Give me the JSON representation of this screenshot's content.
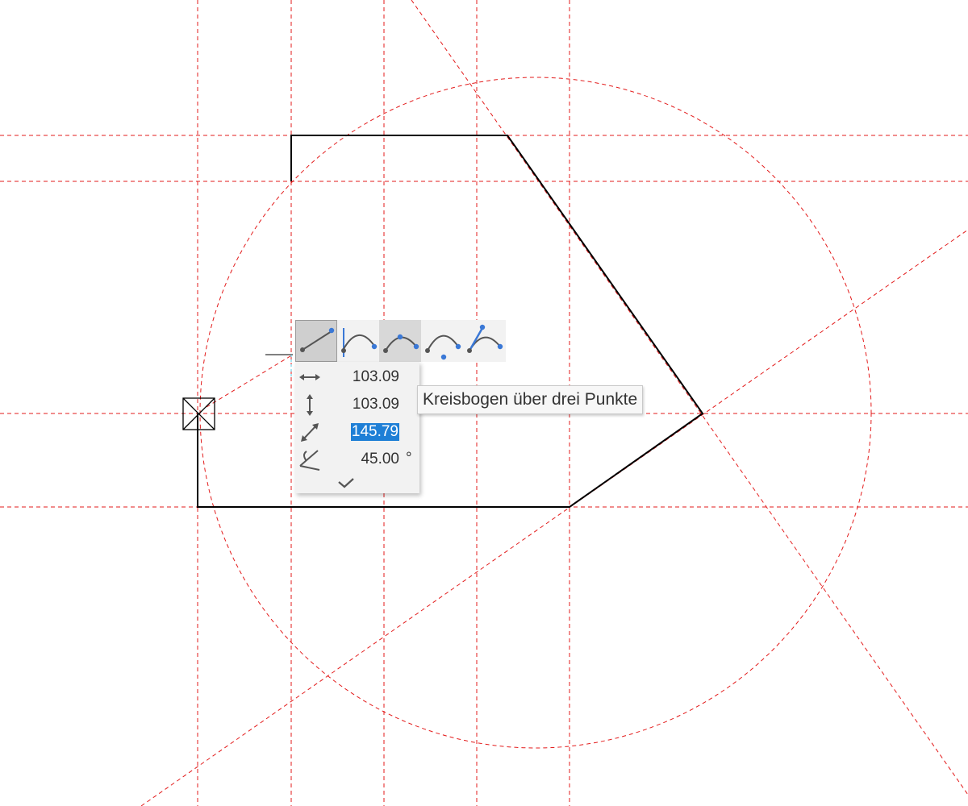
{
  "colors": {
    "construction_line": "#e31b1b",
    "geometry_line": "#000000",
    "accent": "#3a78d6",
    "selection": "#1e7fd6",
    "panel_bg": "#f2f2f2"
  },
  "toolbar": {
    "tools": [
      {
        "name": "line-tool",
        "icon": "line-segment-icon",
        "active": true
      },
      {
        "name": "tangent-arc-tool",
        "icon": "tangent-arc-icon",
        "active": false
      },
      {
        "name": "three-point-arc-tool",
        "icon": "three-point-arc-icon",
        "active": false,
        "hovered": true
      },
      {
        "name": "center-arc-tool",
        "icon": "center-arc-icon",
        "active": false
      },
      {
        "name": "line-arc-tool",
        "icon": "line-arc-icon",
        "active": false
      }
    ]
  },
  "tooltip": {
    "text": "Kreisbogen über drei Punkte"
  },
  "dimensions": {
    "dx": {
      "icon": "horizontal-arrow-icon",
      "value": "103.09"
    },
    "dy": {
      "icon": "vertical-arrow-icon",
      "value": "103.09"
    },
    "length": {
      "icon": "diagonal-arrow-icon",
      "value": "145.79",
      "selected": true
    },
    "angle": {
      "icon": "angle-icon",
      "value": "45.00",
      "unit": "°"
    },
    "confirm_icon": "checkmark-icon"
  },
  "cursor": {
    "icon": "snap-point-icon"
  }
}
